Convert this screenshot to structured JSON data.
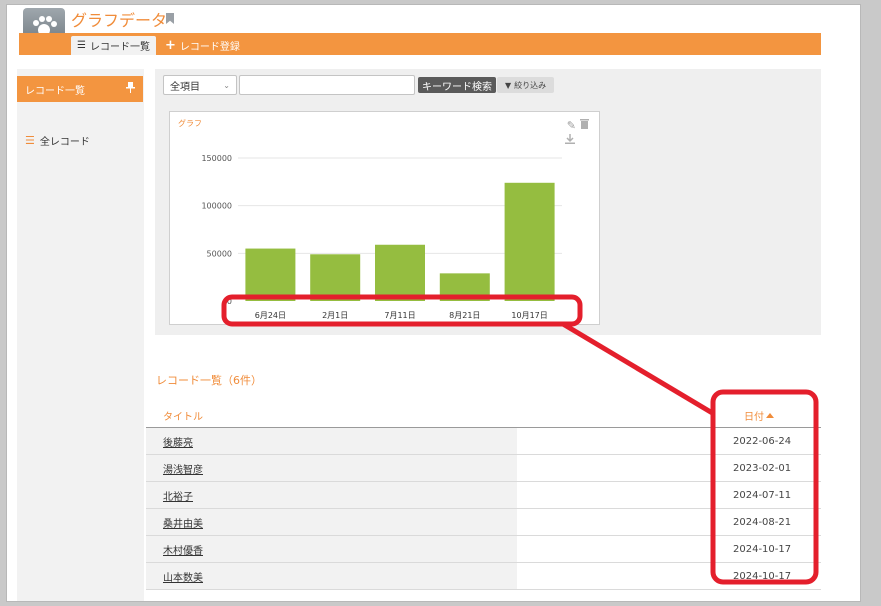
{
  "app": {
    "title": "グラフデータ"
  },
  "tabs": [
    {
      "label": "レコード一覧",
      "icon": "list-icon"
    },
    {
      "label": "レコード登録",
      "icon": "plus-icon"
    }
  ],
  "sidebar": {
    "header": "レコード一覧",
    "items": [
      {
        "label": "全レコード",
        "icon": "list-icon"
      }
    ]
  },
  "filter": {
    "select_value": "全項目",
    "keyword_value": "",
    "search_label": "キーワード検索",
    "narrow_label": "絞り込み"
  },
  "graph": {
    "label": "グラフ"
  },
  "chart_data": {
    "type": "bar",
    "title": "",
    "categories": [
      "6月24日",
      "2月1日",
      "7月11日",
      "8月21日",
      "10月17日"
    ],
    "values": [
      55000,
      49000,
      59000,
      29000,
      124000
    ],
    "yticks": [
      0,
      50000,
      100000,
      150000
    ],
    "ylim": [
      0,
      150000
    ],
    "grid": true,
    "colors": {
      "bar": "#95bd40"
    }
  },
  "list": {
    "title": "レコード一覧（6件）",
    "columns": {
      "title": "タイトル",
      "date": "日付"
    },
    "rows": [
      {
        "title": "後藤亮",
        "date": "2022-06-24"
      },
      {
        "title": "湯浅智彦",
        "date": "2023-02-01"
      },
      {
        "title": "北裕子",
        "date": "2024-07-11"
      },
      {
        "title": "桑井由美",
        "date": "2024-08-21"
      },
      {
        "title": "木村優香",
        "date": "2024-10-17"
      },
      {
        "title": "山本数美",
        "date": "2024-10-17"
      }
    ]
  },
  "colors": {
    "accent": "#f39540",
    "annotation": "#e41f2c"
  }
}
